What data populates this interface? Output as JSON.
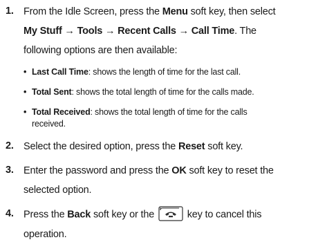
{
  "steps": [
    {
      "number": "1.",
      "line1_a": "From the Idle Screen, press the ",
      "line1_b": "Menu",
      "line1_c": " soft key, then select",
      "line2_a": "My Stuff",
      "line2_arrow1": " → ",
      "line2_b": "Tools",
      "line2_arrow2": " → ",
      "line2_c": "Recent Calls",
      "line2_arrow3": " → ",
      "line2_d": "Call Time",
      "line2_e": ". The",
      "line3": "following options are then available:"
    },
    {
      "number": "2.",
      "line1_a": "Select the desired option, press the ",
      "line1_b": "Reset",
      "line1_c": " soft key."
    },
    {
      "number": "3.",
      "line1_a": "Enter the password and press the ",
      "line1_b": "OK",
      "line1_c": " soft key to reset the",
      "line2": "selected option."
    },
    {
      "number": "4.",
      "line1_a": "Press the ",
      "line1_b": "Back",
      "line1_c": " soft key or the",
      "line1_d": " key to cancel this",
      "line2": "operation.",
      "key_icon": "end-call-key-icon"
    }
  ],
  "bullets": [
    {
      "term": "Last Call Time",
      "text1": ": shows the length of time for the last call."
    },
    {
      "term": "Total Sent",
      "text1": ": shows the total length of time for the calls made."
    },
    {
      "term": "Total Received",
      "text1": ": shows the total length of time for the calls",
      "text2": "received."
    }
  ],
  "bullet_glyph": "•",
  "colors": {
    "text": "#1a1a1a",
    "key_border": "#333333"
  }
}
